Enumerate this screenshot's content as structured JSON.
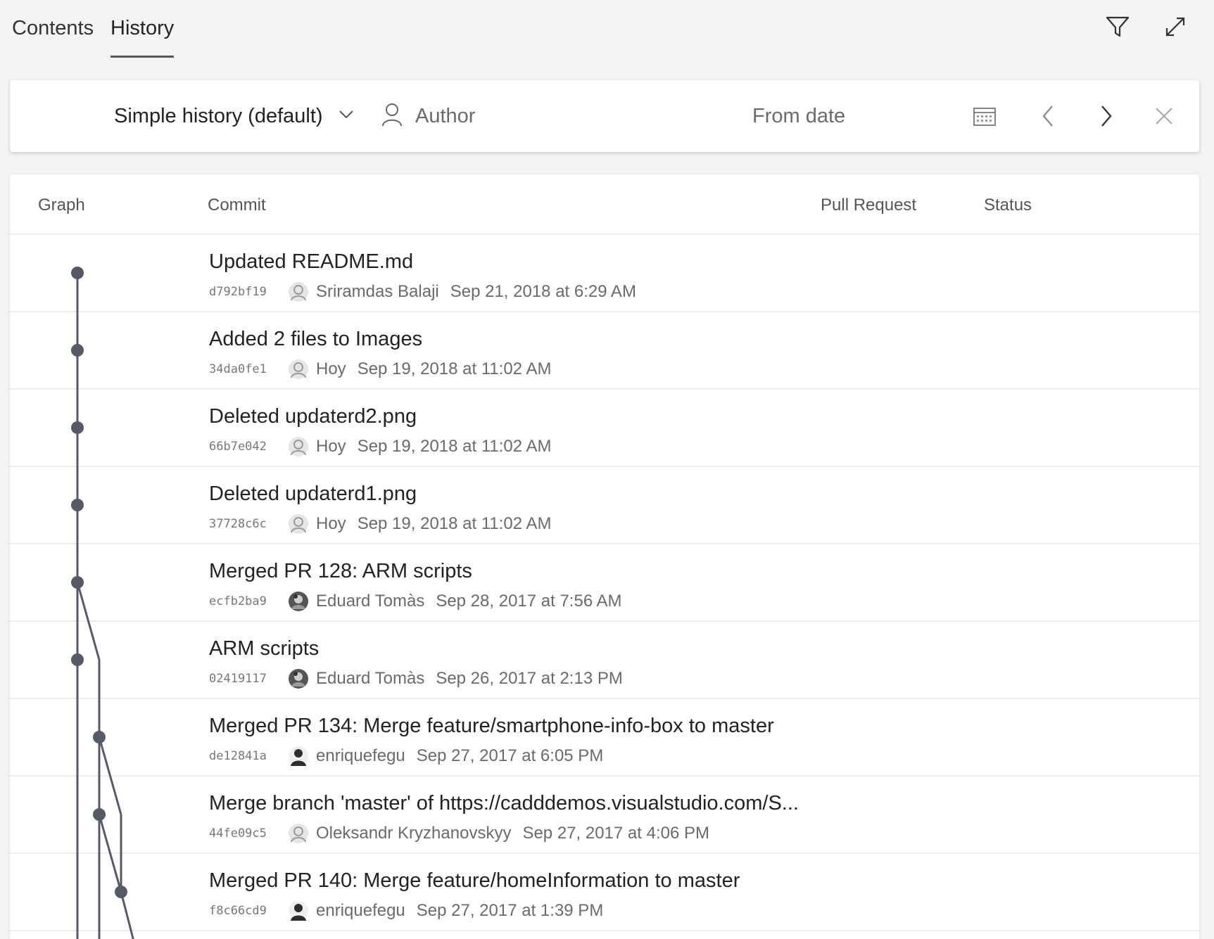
{
  "tabs": [
    {
      "label": "Contents",
      "active": false
    },
    {
      "label": "History",
      "active": true
    }
  ],
  "filter": {
    "history_mode": "Simple history (default)",
    "author_placeholder": "Author",
    "from_date_placeholder": "From date"
  },
  "table": {
    "columns": [
      "Graph",
      "Commit",
      "Pull Request",
      "Status"
    ],
    "rows": [
      {
        "message": "Updated README.md",
        "hash": "d792bf19",
        "author": "Sriramdas Balaji",
        "date": "Sep 21, 2018 at 6:29 AM",
        "avatar": "generic-avatar"
      },
      {
        "message": "Added 2 files to Images",
        "hash": "34da0fe1",
        "author": "Hoy",
        "date": "Sep 19, 2018 at 11:02 AM",
        "avatar": "generic-avatar"
      },
      {
        "message": "Deleted updaterd2.png",
        "hash": "66b7e042",
        "author": "Hoy",
        "date": "Sep 19, 2018 at 11:02 AM",
        "avatar": "generic-avatar"
      },
      {
        "message": "Deleted updaterd1.png",
        "hash": "37728c6c",
        "author": "Hoy",
        "date": "Sep 19, 2018 at 11:02 AM",
        "avatar": "generic-avatar"
      },
      {
        "message": "Merged PR 128: ARM scripts",
        "hash": "ecfb2ba9",
        "author": "Eduard Tomàs",
        "date": "Sep 28, 2017 at 7:56 AM",
        "avatar": "photo-avatar"
      },
      {
        "message": "ARM scripts",
        "hash": "02419117",
        "author": "Eduard Tomàs",
        "date": "Sep 26, 2017 at 2:13 PM",
        "avatar": "photo-avatar"
      },
      {
        "message": "Merged PR 134: Merge feature/smartphone-info-box to master",
        "hash": "de12841a",
        "author": "enriquefegu",
        "date": "Sep 27, 2017 at 6:05 PM",
        "avatar": "person-avatar"
      },
      {
        "message": "Merge branch 'master' of https://cadddemos.visualstudio.com/S...",
        "hash": "44fe09c5",
        "author": "Oleksandr Kryzhanovskyy",
        "date": "Sep 27, 2017 at 4:06 PM",
        "avatar": "generic-avatar"
      },
      {
        "message": "Merged PR 140: Merge feature/homeInformation to master",
        "hash": "f8c66cd9",
        "author": "enriquefegu",
        "date": "Sep 27, 2017 at 1:39 PM",
        "avatar": "person-avatar"
      }
    ]
  },
  "colors": {
    "graph": "#555a66",
    "background": "#f4f4f4",
    "card": "#ffffff"
  },
  "icons": [
    "filter-icon",
    "expand-icon",
    "chevron-down-icon",
    "person-icon",
    "calendar-icon",
    "chevron-left-icon",
    "chevron-right-icon",
    "close-icon"
  ]
}
